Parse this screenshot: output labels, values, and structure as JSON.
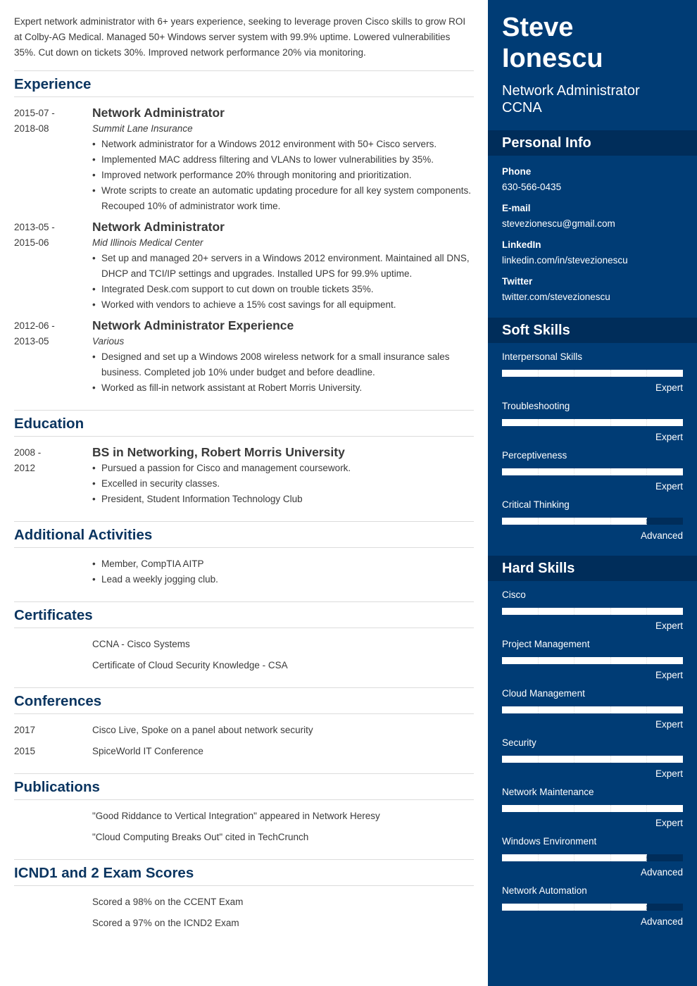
{
  "summary": "Expert network administrator with 6+ years experience, seeking to leverage proven Cisco skills to grow ROI at Colby-AG Medical. Managed 50+ Windows server system with 99.9% uptime. Lowered vulnerabilities 35%. Cut down on tickets 30%. Improved network performance 20% via monitoring.",
  "experience": {
    "title": "Experience",
    "entries": [
      {
        "date_start": "2015-07 -",
        "date_end": "2018-08",
        "title": "Network Administrator",
        "company": "Summit Lane Insurance",
        "bullets": [
          "Network administrator for a Windows 2012  environment with 50+ Cisco servers.",
          "Implemented MAC address filtering and VLANs to lower vulnerabilities by 35%.",
          "Improved network performance 20% through monitoring and prioritization.",
          "Wrote scripts to create an automatic updating procedure for all key system components. Recouped 10% of administrator work time."
        ]
      },
      {
        "date_start": "2013-05 -",
        "date_end": "2015-06",
        "title": "Network Administrator",
        "company": "Mid Illinois Medical Center",
        "bullets": [
          "Set up and managed 20+ servers in a Windows 2012 environment. Maintained all DNS, DHCP and TCI/IP settings and upgrades. Installed UPS for 99.9% uptime.",
          "Integrated Desk.com support to cut down on trouble tickets 35%.",
          "Worked with vendors to achieve a 15% cost savings for all equipment."
        ]
      },
      {
        "date_start": "2012-06 -",
        "date_end": "2013-05",
        "title": "Network Administrator Experience",
        "company": "Various",
        "bullets": [
          "Designed and set up a Windows 2008 wireless network for a small insurance sales business. Completed job 10% under budget and before deadline.",
          "Worked as fill-in network assistant at Robert Morris University."
        ]
      }
    ]
  },
  "education": {
    "title": "Education",
    "entries": [
      {
        "date_start": "2008 -",
        "date_end": "2012",
        "title": "BS in Networking, Robert Morris University",
        "bullets": [
          "Pursued a passion for Cisco and management coursework.",
          "Excelled in security classes.",
          "President, Student Information Technology Club"
        ]
      }
    ]
  },
  "activities": {
    "title": "Additional Activities",
    "bullets": [
      "Member, CompTIA AITP",
      "Lead a weekly jogging club."
    ]
  },
  "certificates": {
    "title": "Certificates",
    "items": [
      "CCNA - Cisco Systems",
      "Certificate of Cloud Security Knowledge - CSA"
    ]
  },
  "conferences": {
    "title": "Conferences",
    "items": [
      {
        "year": "2017",
        "text": "Cisco Live, Spoke on a panel about network security"
      },
      {
        "year": "2015",
        "text": "SpiceWorld IT Conference"
      }
    ]
  },
  "publications": {
    "title": "Publications",
    "items": [
      "\"Good Riddance to Vertical Integration\" appeared in Network Heresy",
      "\"Cloud Computing Breaks Out\" cited in TechCrunch"
    ]
  },
  "exams": {
    "title": "ICND1 and 2 Exam Scores",
    "items": [
      "Scored a 98% on the CCENT Exam",
      "Scored a 97% on the ICND2 Exam"
    ]
  },
  "sidebar": {
    "first_name": "Steve",
    "last_name": "Ionescu",
    "headline_1": "Network Administrator",
    "headline_2": "CCNA",
    "personal_info": {
      "title": "Personal Info",
      "fields": [
        {
          "label": "Phone",
          "value": "630-566-0435"
        },
        {
          "label": "E-mail",
          "value": "stevezionescu@gmail.com"
        },
        {
          "label": "LinkedIn",
          "value": "linkedin.com/in/stevezionescu"
        },
        {
          "label": "Twitter",
          "value": "twitter.com/stevezionescu"
        }
      ]
    },
    "soft_skills": {
      "title": "Soft Skills",
      "items": [
        {
          "name": "Interpersonal Skills",
          "level": "Expert",
          "rating": 5,
          "max": 5
        },
        {
          "name": "Troubleshooting",
          "level": "Expert",
          "rating": 5,
          "max": 5
        },
        {
          "name": "Perceptiveness",
          "level": "Expert",
          "rating": 5,
          "max": 5
        },
        {
          "name": "Critical Thinking",
          "level": "Advanced",
          "rating": 4,
          "max": 5
        }
      ]
    },
    "hard_skills": {
      "title": "Hard Skills",
      "items": [
        {
          "name": "Cisco",
          "level": "Expert",
          "rating": 5,
          "max": 5
        },
        {
          "name": "Project Management",
          "level": "Expert",
          "rating": 5,
          "max": 5
        },
        {
          "name": "Cloud Management",
          "level": "Expert",
          "rating": 5,
          "max": 5
        },
        {
          "name": "Security",
          "level": "Expert",
          "rating": 5,
          "max": 5
        },
        {
          "name": "Network Maintenance",
          "level": "Expert",
          "rating": 5,
          "max": 5
        },
        {
          "name": "Windows Environment",
          "level": "Advanced",
          "rating": 4,
          "max": 5
        },
        {
          "name": "Network Automation",
          "level": "Advanced",
          "rating": 4,
          "max": 5
        }
      ]
    }
  }
}
